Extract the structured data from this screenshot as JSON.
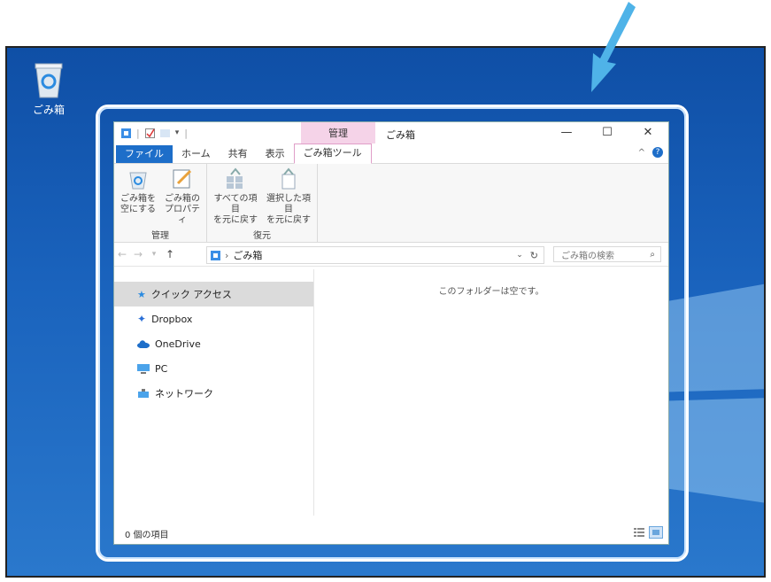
{
  "desktop": {
    "recycle_label": "ごみ箱"
  },
  "window": {
    "context_tab": "管理",
    "title": "ごみ箱",
    "controls": {
      "minimize": "—",
      "maximize": "☐",
      "close": "✕"
    }
  },
  "ribbon_tabs": {
    "file": "ファイル",
    "home": "ホーム",
    "share": "共有",
    "view": "表示",
    "recycle_tools": "ごみ箱ツール"
  },
  "ribbon": {
    "manage_group": {
      "label": "管理",
      "empty_line1": "ごみ箱を",
      "empty_line2": "空にする",
      "props_line1": "ごみ箱の",
      "props_line2": "プロパティ"
    },
    "restore_group": {
      "label": "復元",
      "restore_all_line1": "すべての項目",
      "restore_all_line2": "を元に戻す",
      "restore_sel_line1": "選択した項目",
      "restore_sel_line2": "を元に戻す"
    }
  },
  "address": {
    "breadcrumb": "ごみ箱",
    "search_placeholder": "ごみ箱の検索"
  },
  "nav_items": [
    {
      "label": "クイック アクセス"
    },
    {
      "label": "Dropbox"
    },
    {
      "label": "OneDrive"
    },
    {
      "label": "PC"
    },
    {
      "label": "ネットワーク"
    }
  ],
  "content": {
    "empty_message": "このフォルダーは空です。"
  },
  "status": {
    "item_count": "0 個の項目"
  },
  "colors": {
    "accent": "#1d6ec9",
    "context_tab": "#f5d3e8",
    "desktop": "#1a63bd",
    "highlight_arrow": "#4fb3e8"
  }
}
